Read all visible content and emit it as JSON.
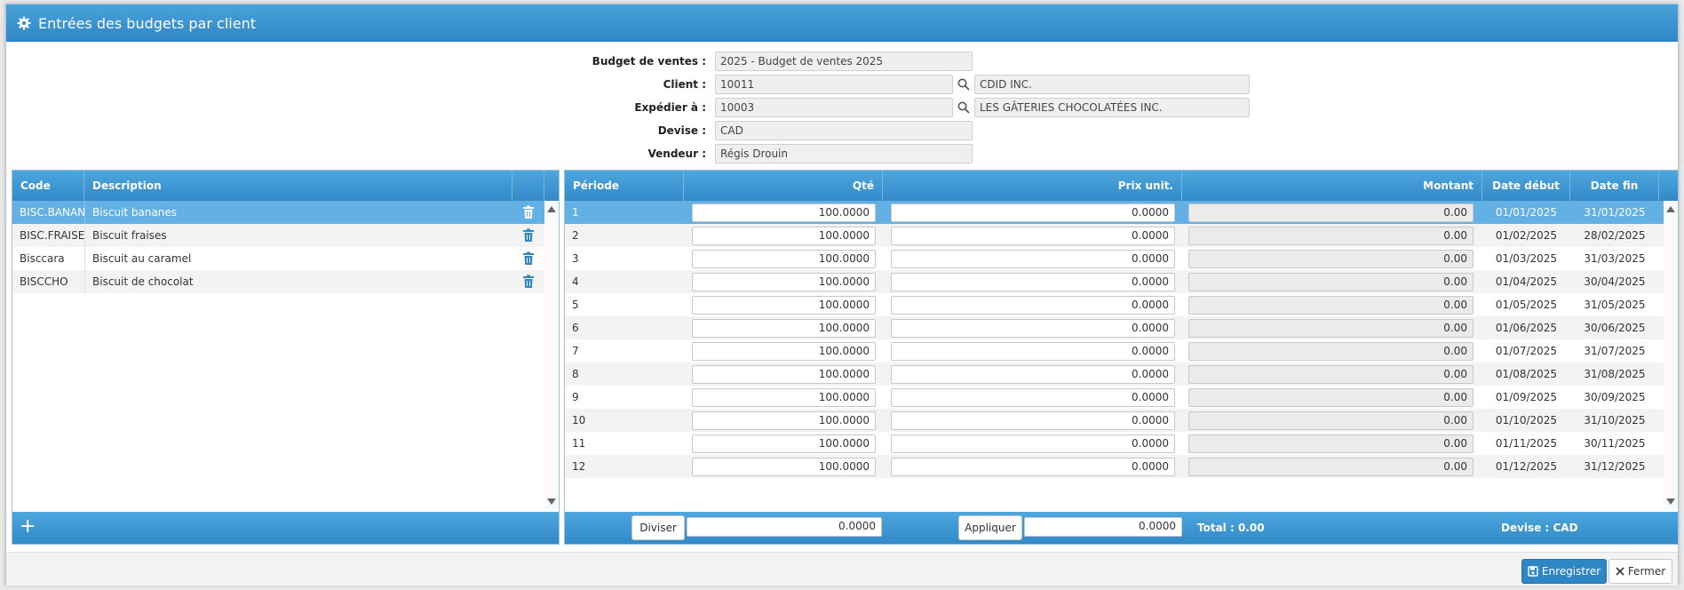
{
  "window": {
    "title": "Entrées des budgets par client"
  },
  "form": {
    "budget_label": "Budget de ventes :",
    "budget_value": "2025 - Budget de ventes 2025",
    "client_label": "Client :",
    "client_code": "10011",
    "client_name": "CDID INC.",
    "ship_label": "Expédier à :",
    "ship_code": "10003",
    "ship_name": "LES GÂTERIES CHOCOLATÉES INC.",
    "currency_label": "Devise :",
    "currency_value": "CAD",
    "seller_label": "Vendeur :",
    "seller_value": "Régis Drouin"
  },
  "products": {
    "headers": {
      "code": "Code",
      "description": "Description"
    },
    "rows": [
      {
        "code": "BISC.BANANES",
        "description": "Biscuit bananes"
      },
      {
        "code": "BISC.FRAISES",
        "description": "Biscuit fraises"
      },
      {
        "code": "Bisccara",
        "description": "Biscuit au caramel"
      },
      {
        "code": "BISCCHO",
        "description": "Biscuit de chocolat"
      }
    ],
    "add_label": "+"
  },
  "periods": {
    "headers": {
      "period": "Période",
      "qty": "Qté",
      "unit_price": "Prix unit.",
      "amount": "Montant",
      "start": "Date début",
      "end": "Date fin"
    },
    "rows": [
      {
        "period": "1",
        "qty": "100.0000",
        "price": "0.0000",
        "amount": "0.00",
        "start": "01/01/2025",
        "end": "31/01/2025"
      },
      {
        "period": "2",
        "qty": "100.0000",
        "price": "0.0000",
        "amount": "0.00",
        "start": "01/02/2025",
        "end": "28/02/2025"
      },
      {
        "period": "3",
        "qty": "100.0000",
        "price": "0.0000",
        "amount": "0.00",
        "start": "01/03/2025",
        "end": "31/03/2025"
      },
      {
        "period": "4",
        "qty": "100.0000",
        "price": "0.0000",
        "amount": "0.00",
        "start": "01/04/2025",
        "end": "30/04/2025"
      },
      {
        "period": "5",
        "qty": "100.0000",
        "price": "0.0000",
        "amount": "0.00",
        "start": "01/05/2025",
        "end": "31/05/2025"
      },
      {
        "period": "6",
        "qty": "100.0000",
        "price": "0.0000",
        "amount": "0.00",
        "start": "01/06/2025",
        "end": "30/06/2025"
      },
      {
        "period": "7",
        "qty": "100.0000",
        "price": "0.0000",
        "amount": "0.00",
        "start": "01/07/2025",
        "end": "31/07/2025"
      },
      {
        "period": "8",
        "qty": "100.0000",
        "price": "0.0000",
        "amount": "0.00",
        "start": "01/08/2025",
        "end": "31/08/2025"
      },
      {
        "period": "9",
        "qty": "100.0000",
        "price": "0.0000",
        "amount": "0.00",
        "start": "01/09/2025",
        "end": "30/09/2025"
      },
      {
        "period": "10",
        "qty": "100.0000",
        "price": "0.0000",
        "amount": "0.00",
        "start": "01/10/2025",
        "end": "31/10/2025"
      },
      {
        "period": "11",
        "qty": "100.0000",
        "price": "0.0000",
        "amount": "0.00",
        "start": "01/11/2025",
        "end": "30/11/2025"
      },
      {
        "period": "12",
        "qty": "100.0000",
        "price": "0.0000",
        "amount": "0.00",
        "start": "01/12/2025",
        "end": "31/12/2025"
      }
    ],
    "footer": {
      "divide_label": "Diviser",
      "divide_value": "0.0000",
      "apply_label": "Appliquer",
      "apply_value": "0.0000",
      "total_text": "Total : 0.00",
      "currency_text": "Devise : CAD"
    }
  },
  "actions": {
    "save_label": "Enregistrer",
    "close_label": "Fermer"
  },
  "colors": {
    "header_blue": "#3189c8",
    "selected_row": "#62b0e4"
  }
}
